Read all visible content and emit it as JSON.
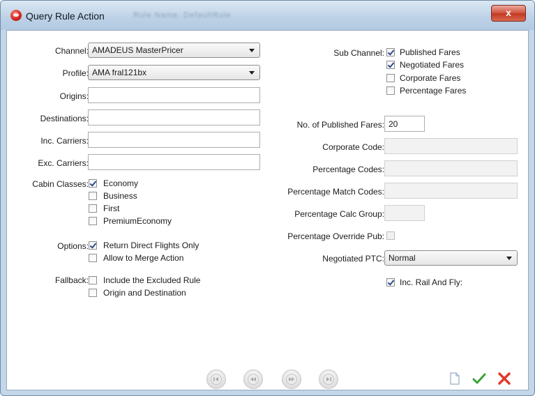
{
  "window": {
    "title": "Query Rule Action",
    "ghost_title": "Rule Name: DefaultRule",
    "close_label": "x"
  },
  "left": {
    "channel": {
      "label": "Channel:",
      "value": "AMADEUS MasterPricer"
    },
    "profile": {
      "label": "Profile:",
      "value": "AMA fral121bx"
    },
    "origins": {
      "label": "Origins:",
      "value": ""
    },
    "destinations": {
      "label": "Destinations:",
      "value": ""
    },
    "inc_carriers": {
      "label": "Inc. Carriers:",
      "value": ""
    },
    "exc_carriers": {
      "label": "Exc. Carriers:",
      "value": ""
    },
    "cabin_classes": {
      "label": "Cabin Classes:",
      "items": [
        {
          "label": "Economy",
          "checked": true
        },
        {
          "label": "Business",
          "checked": false
        },
        {
          "label": "First",
          "checked": false
        },
        {
          "label": "PremiumEconomy",
          "checked": false
        }
      ]
    },
    "options": {
      "label": "Options:",
      "items": [
        {
          "label": "Return Direct Flights Only",
          "checked": true
        },
        {
          "label": "Allow to Merge Action",
          "checked": false
        }
      ]
    },
    "fallback": {
      "label": "Fallback:",
      "items": [
        {
          "label": "Include the Excluded Rule",
          "checked": false
        },
        {
          "label": "Origin and Destination",
          "checked": false
        }
      ]
    }
  },
  "right": {
    "sub_channel": {
      "label": "Sub Channel:",
      "items": [
        {
          "label": "Published Fares",
          "checked": true
        },
        {
          "label": "Negotiated Fares",
          "checked": true
        },
        {
          "label": "Corporate Fares",
          "checked": false
        },
        {
          "label": "Percentage Fares",
          "checked": false
        }
      ]
    },
    "num_published_fares": {
      "label": "No. of Published Fares:",
      "value": "20"
    },
    "corporate_code": {
      "label": "Corporate Code:",
      "value": ""
    },
    "percentage_codes": {
      "label": "Percentage Codes:",
      "value": ""
    },
    "percentage_match_codes": {
      "label": "Percentage Match Codes:",
      "value": ""
    },
    "percentage_calc_group": {
      "label": "Percentage Calc Group:",
      "value": ""
    },
    "percentage_override_pub": {
      "label": "Percentage Override Pub:",
      "checked": false
    },
    "negotiated_ptc": {
      "label": "Negotiated PTC:",
      "value": "Normal"
    },
    "inc_rail_and_fly": {
      "label": "Inc. Rail And Fly:",
      "checked": true
    }
  },
  "icons": {
    "nav": [
      "first-record-icon",
      "previous-record-icon",
      "next-record-icon",
      "last-record-icon"
    ],
    "actions": [
      "new-document-icon",
      "confirm-check-icon",
      "cancel-x-icon"
    ]
  },
  "colors": {
    "confirm_green": "#3aa335",
    "cancel_red": "#e0392b",
    "close_button_red": "#c8432c",
    "title_bar": "#c4d7ea"
  }
}
